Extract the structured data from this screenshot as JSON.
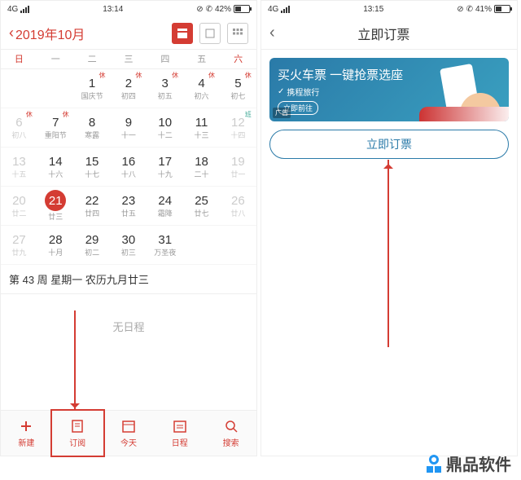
{
  "left": {
    "statusbar": {
      "network": "4G",
      "time": "13:14",
      "battery": "42%"
    },
    "header": {
      "title": "2019年10月"
    },
    "weekdays": [
      "日",
      "一",
      "二",
      "三",
      "四",
      "五",
      "六"
    ],
    "grid": [
      {
        "d": "",
        "l": ""
      },
      {
        "d": "",
        "l": ""
      },
      {
        "d": "1",
        "l": "国庆节",
        "b": "休"
      },
      {
        "d": "2",
        "l": "初四",
        "b": "休"
      },
      {
        "d": "3",
        "l": "初五",
        "b": "休"
      },
      {
        "d": "4",
        "l": "初六",
        "b": "休"
      },
      {
        "d": "5",
        "l": "初七",
        "b": "休"
      },
      {
        "d": "6",
        "l": "初八",
        "b": "休",
        "g": 1
      },
      {
        "d": "7",
        "l": "重阳节",
        "b": "休"
      },
      {
        "d": "8",
        "l": "寒露"
      },
      {
        "d": "9",
        "l": "十一"
      },
      {
        "d": "10",
        "l": "十二"
      },
      {
        "d": "11",
        "l": "十三"
      },
      {
        "d": "12",
        "l": "十四",
        "b": "班",
        "g": 1
      },
      {
        "d": "13",
        "l": "十五",
        "g": 1
      },
      {
        "d": "14",
        "l": "十六"
      },
      {
        "d": "15",
        "l": "十七"
      },
      {
        "d": "16",
        "l": "十八"
      },
      {
        "d": "17",
        "l": "十九"
      },
      {
        "d": "18",
        "l": "二十"
      },
      {
        "d": "19",
        "l": "廿一",
        "g": 1
      },
      {
        "d": "20",
        "l": "廿二",
        "g": 1
      },
      {
        "d": "21",
        "l": "廿三",
        "t": 1
      },
      {
        "d": "22",
        "l": "廿四"
      },
      {
        "d": "23",
        "l": "廿五"
      },
      {
        "d": "24",
        "l": "霜降"
      },
      {
        "d": "25",
        "l": "廿七"
      },
      {
        "d": "26",
        "l": "廿八",
        "g": 1
      },
      {
        "d": "27",
        "l": "廿九",
        "g": 1
      },
      {
        "d": "28",
        "l": "十月"
      },
      {
        "d": "29",
        "l": "初二"
      },
      {
        "d": "30",
        "l": "初三"
      },
      {
        "d": "31",
        "l": "万圣夜"
      },
      {
        "d": "",
        "l": ""
      },
      {
        "d": "",
        "l": ""
      }
    ],
    "info": "第 43 周  星期一  农历九月廿三",
    "noevent": "无日程",
    "bottom": [
      {
        "label": "新建"
      },
      {
        "label": "订阅"
      },
      {
        "label": "今天"
      },
      {
        "label": "日程"
      },
      {
        "label": "搜索"
      }
    ]
  },
  "right": {
    "statusbar": {
      "network": "4G",
      "time": "13:15",
      "battery": "41%"
    },
    "header": {
      "title": "立即订票"
    },
    "banner": {
      "text": "买火车票 一键抢票选座",
      "sub": "携程旅行",
      "btn": "立即前往",
      "ad": "广告"
    },
    "button": "立即订票"
  },
  "logo": "鼎品软件"
}
